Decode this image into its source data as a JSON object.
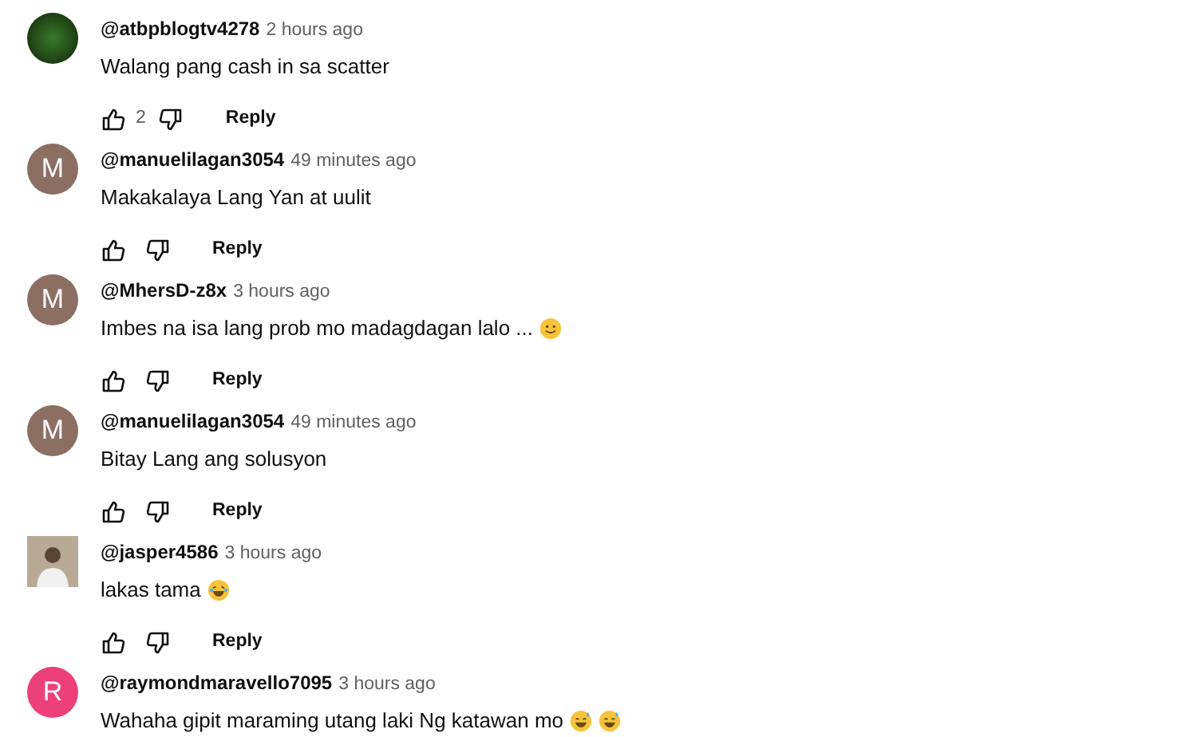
{
  "comments": [
    {
      "avatar": {
        "kind": "photo"
      },
      "author": "@atbpblogtv4278",
      "time": "2 hours ago",
      "text": "Walang pang cash in sa scatter",
      "likes": "2",
      "reply": "Reply"
    },
    {
      "avatar": {
        "kind": "letter",
        "letter": "M",
        "color": "#8d6e63"
      },
      "author": "@manuelilagan3054",
      "time": "49 minutes ago",
      "text": "Makakalaya Lang Yan at uulit",
      "reply": "Reply"
    },
    {
      "avatar": {
        "kind": "letter",
        "letter": "M",
        "color": "#8d6e63"
      },
      "author": "@MhersD-z8x",
      "time": "3 hours ago",
      "text": "Imbes na isa lang prob mo madagdagan lalo ...",
      "emojis": [
        {
          "kind": "smile"
        }
      ],
      "reply": "Reply"
    },
    {
      "avatar": {
        "kind": "letter",
        "letter": "M",
        "color": "#8d6e63"
      },
      "author": "@manuelilagan3054",
      "time": "49 minutes ago",
      "text": "Bitay Lang ang solusyon",
      "reply": "Reply"
    },
    {
      "avatar": {
        "kind": "person"
      },
      "author": "@jasper4586",
      "time": "3 hours ago",
      "text": "lakas tama",
      "emojis": [
        {
          "kind": "laugh"
        }
      ],
      "reply": "Reply"
    },
    {
      "avatar": {
        "kind": "letter",
        "letter": "R",
        "color": "#ec407a"
      },
      "author": "@raymondmaravello7095",
      "time": "3 hours ago",
      "text": "Wahaha gipit maraming utang laki Ng katawan mo",
      "emojis": [
        {
          "kind": "sweat"
        },
        {
          "kind": "sweat"
        }
      ]
    }
  ]
}
